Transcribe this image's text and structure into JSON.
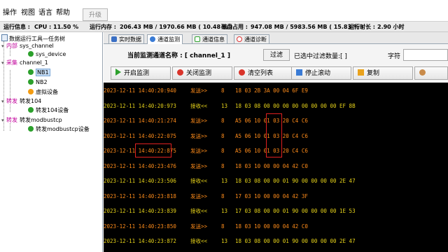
{
  "menu": {
    "items": [
      "操作",
      "视图",
      "语言",
      "帮助"
    ],
    "upgrade_label": "升级"
  },
  "status": {
    "cpu_label": "运行信息 :",
    "cpu_value": "CPU : 11.50 %",
    "mem_label": "运行内存 :",
    "mem_value": "206.43 MB / 1970.66 MB ( 10.48 % )",
    "disk_label": "磁盘占用 :",
    "disk_value": "947.08 MB / 5983.56 MB ( 15.83 % )",
    "uptime_label": "运行时长 :",
    "uptime_value": "2.90 小时"
  },
  "tree": {
    "root": "数据运行工具—任务树",
    "internal_tag": "内部",
    "internal_name": "sys_channel",
    "sys_device": "sys_device",
    "collect_tag": "采集",
    "collect_name": "channel_1",
    "nb1": "NB1",
    "nb2": "NB2",
    "virtual": "虚拟设备",
    "forward1_tag": "转发",
    "forward1_name": "转发104",
    "forward1_device": "转发104设备",
    "forward2_tag": "转发",
    "forward2_name": "转发modbustcp",
    "forward2_device": "转发modbustcp设备"
  },
  "tabs": [
    "实时数据",
    "通道监测",
    "通道信息",
    "通道诊断"
  ],
  "monitor": {
    "current_label": "当前监测通道名称 : [ channel_1 ]",
    "filter_label": "过滤",
    "filter_count": "已选中过滤数量:[ ]",
    "char_label": "字符",
    "char_value": ""
  },
  "actions": {
    "start": "开启监测",
    "stop": "关闭监测",
    "clear": "清空列表",
    "pause": "停止滚动",
    "copy": "复制"
  },
  "log": [
    {
      "time": "2023-12-11 14:40:20:940",
      "dir": "发送>>",
      "len": "8",
      "data": "18 03 2B 3A 00 04 6F E9",
      "type": "send"
    },
    {
      "time": "2023-12-11 14:40:20:973",
      "dir": "接收<<",
      "len": "13",
      "data": "18 03 08 00 00 00 00 00 00 00 00 EF 8B",
      "type": "recv"
    },
    {
      "time": "2023-12-11 14:40:21:274",
      "dir": "发送>>",
      "len": "8",
      "data": "A5 06 10 01 03 20 C4 C6",
      "type": "send"
    },
    {
      "time": "2023-12-11 14:40:22:075",
      "dir": "发送>>",
      "len": "8",
      "data": "A5 06 10 01 03 20 C4 C6",
      "type": "send"
    },
    {
      "time": "2023-12-11 14:40:22:875",
      "dir": "发送>>",
      "len": "8",
      "data": "A5 06 10 01 03 20 C4 C6",
      "type": "send"
    },
    {
      "time": "2023-12-11 14:40:23:476",
      "dir": "发送>>",
      "len": "8",
      "data": "18 03 10 00 00 04 42 C0",
      "type": "send"
    },
    {
      "time": "2023-12-11 14:40:23:506",
      "dir": "接收<<",
      "len": "13",
      "data": "18 03 08 00 00 01 90 00 00 00 00 2E 47",
      "type": "recv"
    },
    {
      "time": "2023-12-11 14:40:23:818",
      "dir": "发送>>",
      "len": "8",
      "data": "17 03 10 00 00 04 42 3F",
      "type": "send"
    },
    {
      "time": "2023-12-11 14:40:23:839",
      "dir": "接收<<",
      "len": "13",
      "data": "17 03 08 00 00 01 90 00 00 00 00 1E 53",
      "type": "recv"
    },
    {
      "time": "2023-12-11 14:40:23:850",
      "dir": "发送>>",
      "len": "8",
      "data": "18 03 10 00 00 04 42 C0",
      "type": "send"
    },
    {
      "time": "2023-12-11 14:40:23:872",
      "dir": "接收<<",
      "len": "13",
      "data": "18 03 08 00 00 01 90 00 00 00 00 2E 47",
      "type": "recv"
    }
  ],
  "colors": {
    "send": "#ff8c1a",
    "recv": "#e6d21a",
    "highlight": "#e02020"
  }
}
